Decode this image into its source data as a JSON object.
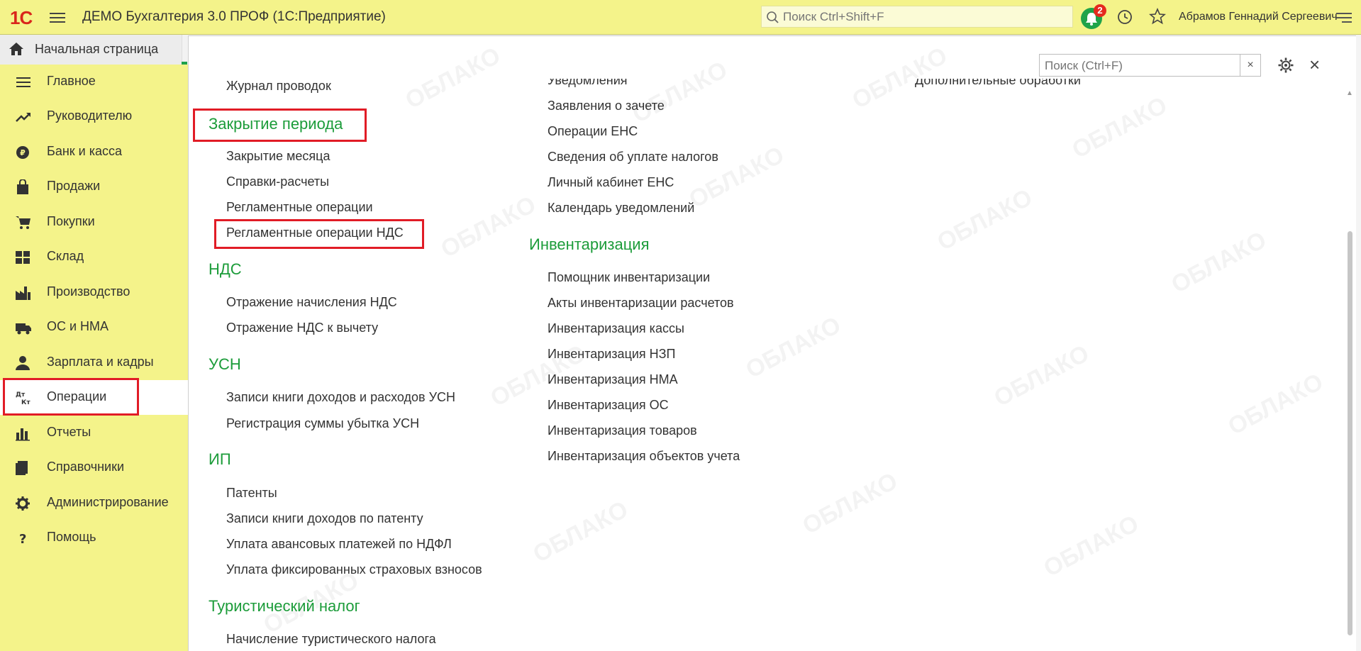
{
  "app": {
    "logo": "1С",
    "title": "ДЕМО Бухгалтерия 3.0 ПРОФ  (1С:Предприятие)",
    "search_placeholder": "Поиск Ctrl+Shift+F",
    "notifications_count": "2",
    "user_name": "Абрамов Геннадий Сергеевич"
  },
  "home_tab": {
    "label": "Начальная страница"
  },
  "sidebar": {
    "items": [
      {
        "label": "Главное",
        "icon": "menu-icon"
      },
      {
        "label": "Руководителю",
        "icon": "trend-icon"
      },
      {
        "label": "Банк и касса",
        "icon": "coin-icon"
      },
      {
        "label": "Продажи",
        "icon": "bag-icon"
      },
      {
        "label": "Покупки",
        "icon": "cart-icon"
      },
      {
        "label": "Склад",
        "icon": "grid-icon"
      },
      {
        "label": "Производство",
        "icon": "factory-icon"
      },
      {
        "label": "ОС и НМА",
        "icon": "truck-icon"
      },
      {
        "label": "Зарплата и кадры",
        "icon": "person-icon"
      },
      {
        "label": "Операции",
        "icon": "dt-kt-icon",
        "active": true
      },
      {
        "label": "Отчеты",
        "icon": "bar-chart-icon"
      },
      {
        "label": "Справочники",
        "icon": "books-icon"
      },
      {
        "label": "Администрирование",
        "icon": "gear-icon"
      },
      {
        "label": "Помощь",
        "icon": "question-icon"
      }
    ],
    "dtkt_top": "Дт",
    "dtkt_bottom": "Кт"
  },
  "panel": {
    "search_placeholder": "Поиск (Ctrl+F)",
    "clear_label": "×",
    "close_label": "×",
    "col1": {
      "top_link": "Журнал проводок",
      "sections": [
        {
          "title": "Закрытие периода",
          "links": [
            "Закрытие месяца",
            "Справки-расчеты",
            "Регламентные операции",
            "Регламентные операции НДС"
          ]
        },
        {
          "title": "НДС",
          "links": [
            "Отражение начисления НДС",
            "Отражение НДС к вычету"
          ]
        },
        {
          "title": "УСН",
          "links": [
            "Записи книги доходов и расходов УСН",
            "Регистрация суммы убытка УСН"
          ]
        },
        {
          "title": "ИП",
          "links": [
            "Патенты",
            "Записи книги доходов по патенту",
            "Уплата авансовых платежей по НДФЛ",
            "Уплата фиксированных страховых взносов"
          ]
        },
        {
          "title": "Туристический налог",
          "links": [
            "Начисление туристического налога"
          ]
        }
      ]
    },
    "col2": {
      "top_links": [
        "Уведомления",
        "Заявления о зачете",
        "Операции ЕНС",
        "Сведения об уплате налогов",
        "Личный кабинет ЕНС",
        "Календарь уведомлений"
      ],
      "sections": [
        {
          "title": "Инвентаризация",
          "links": [
            "Помощник инвентаризации",
            "Акты инвентаризации расчетов",
            "Инвентаризация кассы",
            "Инвентаризация НЗП",
            "Инвентаризация НМА",
            "Инвентаризация ОС",
            "Инвентаризация товаров",
            "Инвентаризация объектов учета"
          ]
        }
      ]
    },
    "col3": {
      "top_link": "Дополнительные обработки"
    }
  },
  "watermark": "ОБЛАКО",
  "colors": {
    "accent_yellow": "#f4f38a",
    "section_green": "#1c9c3a",
    "highlight_red": "#e11c26",
    "logo_red": "#d9261c"
  }
}
